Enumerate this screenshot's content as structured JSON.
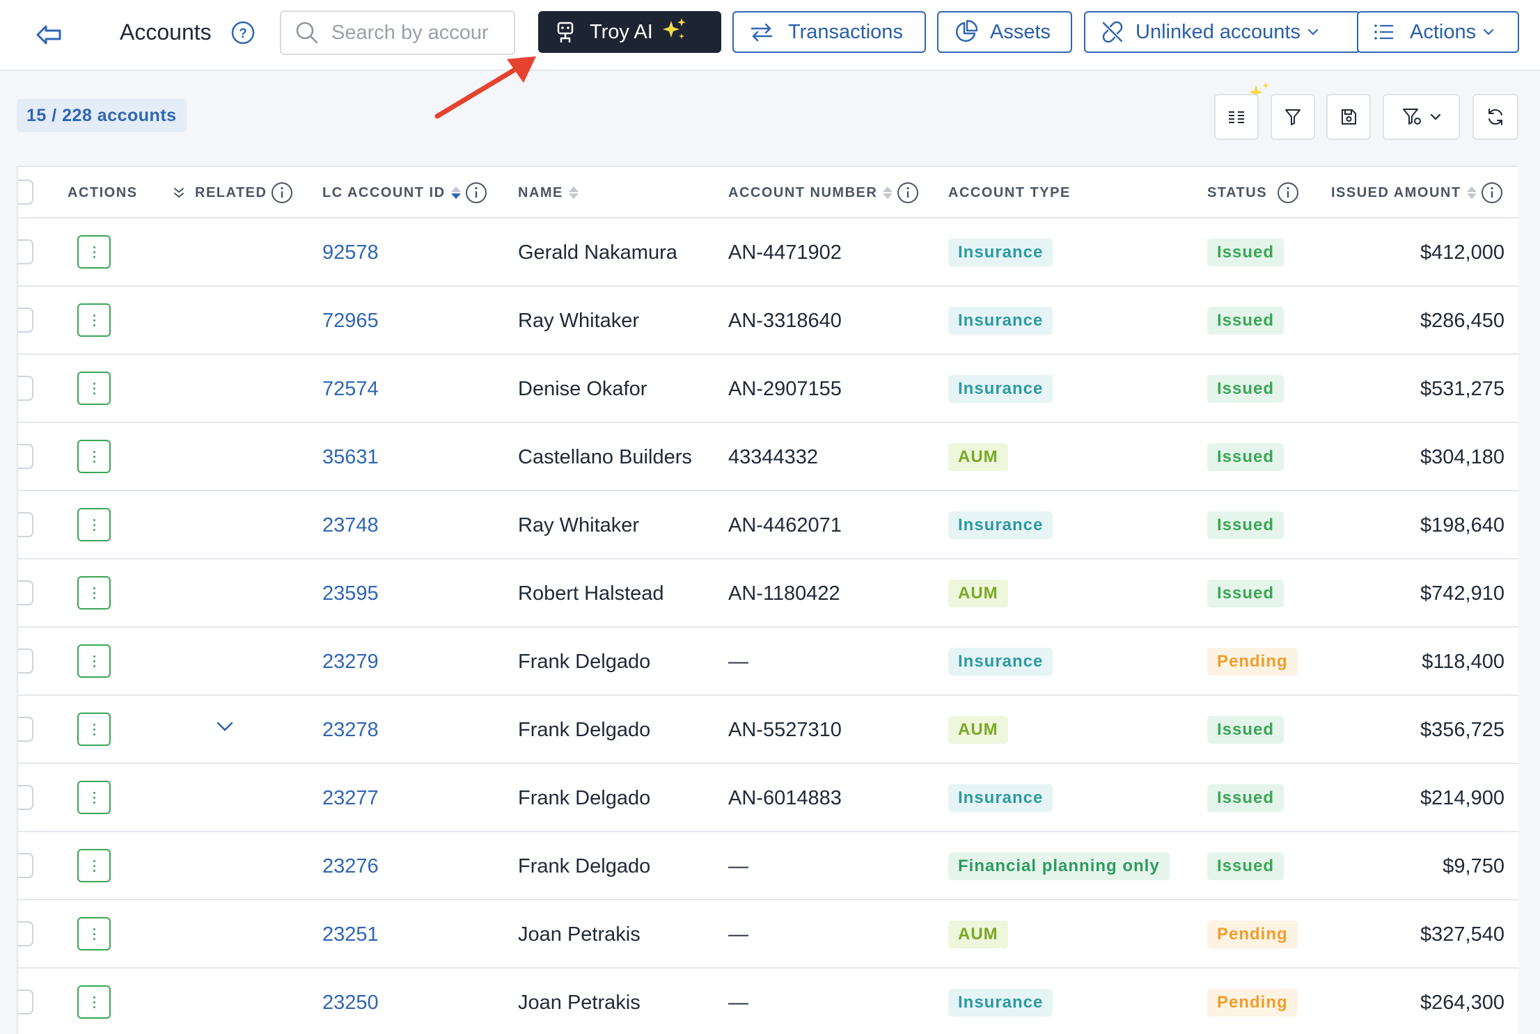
{
  "header": {
    "title": "Accounts",
    "search_placeholder": "Search by accour",
    "buttons": {
      "troy": "Troy AI",
      "transactions": "Transactions",
      "assets": "Assets",
      "unlinked": "Unlinked accounts",
      "actions": "Actions"
    }
  },
  "summary": {
    "count_label": "15 / 228 accounts"
  },
  "table": {
    "columns": {
      "actions": "ACTIONS",
      "related": "RELATED",
      "lc_account_id": "LC ACCOUNT ID",
      "name": "NAME",
      "account_number": "ACCOUNT NUMBER",
      "account_type": "ACCOUNT TYPE",
      "status": "STATUS",
      "issued_amount": "ISSUED AMOUNT"
    },
    "rows": [
      {
        "id": "92578",
        "name": "Gerald Nakamura",
        "account_number": "AN-4471902",
        "type": "Insurance",
        "type_class": "insurance",
        "status": "Issued",
        "status_class": "issued",
        "amount": "$412,000",
        "related": false
      },
      {
        "id": "72965",
        "name": "Ray Whitaker",
        "account_number": "AN-3318640",
        "type": "Insurance",
        "type_class": "insurance",
        "status": "Issued",
        "status_class": "issued",
        "amount": "$286,450",
        "related": false
      },
      {
        "id": "72574",
        "name": "Denise Okafor",
        "account_number": "AN-2907155",
        "type": "Insurance",
        "type_class": "insurance",
        "status": "Issued",
        "status_class": "issued",
        "amount": "$531,275",
        "related": false
      },
      {
        "id": "35631",
        "name": "Castellano Builders",
        "account_number": "43344332",
        "type": "AUM",
        "type_class": "aum",
        "status": "Issued",
        "status_class": "issued",
        "amount": "$304,180",
        "related": false
      },
      {
        "id": "23748",
        "name": "Ray Whitaker",
        "account_number": "AN-4462071",
        "type": "Insurance",
        "type_class": "insurance",
        "status": "Issued",
        "status_class": "issued",
        "amount": "$198,640",
        "related": false
      },
      {
        "id": "23595",
        "name": "Robert Halstead",
        "account_number": "AN-1180422",
        "type": "AUM",
        "type_class": "aum",
        "status": "Issued",
        "status_class": "issued",
        "amount": "$742,910",
        "related": false
      },
      {
        "id": "23279",
        "name": "Frank Delgado",
        "account_number": "—",
        "type": "Insurance",
        "type_class": "insurance",
        "status": "Pending",
        "status_class": "pending",
        "amount": "$118,400",
        "related": false
      },
      {
        "id": "23278",
        "name": "Frank Delgado",
        "account_number": "AN-5527310",
        "type": "AUM",
        "type_class": "aum",
        "status": "Issued",
        "status_class": "issued",
        "amount": "$356,725",
        "related": true
      },
      {
        "id": "23277",
        "name": "Frank Delgado",
        "account_number": "AN-6014883",
        "type": "Insurance",
        "type_class": "insurance",
        "status": "Issued",
        "status_class": "issued",
        "amount": "$214,900",
        "related": false
      },
      {
        "id": "23276",
        "name": "Frank Delgado",
        "account_number": "—",
        "type": "Financial planning only",
        "type_class": "fpo",
        "status": "Issued",
        "status_class": "issued",
        "amount": "$9,750",
        "related": false
      },
      {
        "id": "23251",
        "name": "Joan Petrakis",
        "account_number": "—",
        "type": "AUM",
        "type_class": "aum",
        "status": "Pending",
        "status_class": "pending",
        "amount": "$327,540",
        "related": false
      },
      {
        "id": "23250",
        "name": "Joan Petrakis",
        "account_number": "—",
        "type": "Insurance",
        "type_class": "insurance",
        "status": "Pending",
        "status_class": "pending",
        "amount": "$264,300",
        "related": false
      }
    ]
  },
  "colors": {
    "primary": "#2f66b3",
    "dark_button": "#1d2533",
    "issued": "#3aa655",
    "pending": "#ef9e2d",
    "insurance": "#2c9aa3",
    "aum": "#7aa824",
    "annotation_arrow": "#e5432f"
  },
  "icons": [
    "back-arrow-icon",
    "help-icon",
    "search-icon",
    "robot-icon",
    "sparkles-icon",
    "swap-arrows-icon",
    "pie-chart-icon",
    "unlink-icon",
    "list-icon",
    "chevron-down-icon",
    "columns-icon",
    "filter-icon",
    "save-icon",
    "filter-settings-icon",
    "refresh-icon",
    "info-icon",
    "kebab-icon"
  ]
}
